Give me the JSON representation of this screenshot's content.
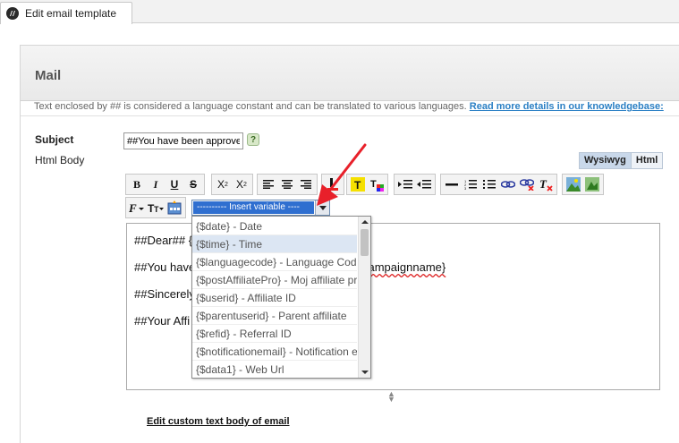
{
  "tab": {
    "label": "Edit email template",
    "icon": "app-logo-icon"
  },
  "panel": {
    "title": "Mail",
    "note": "Text enclosed by ## is considered a language constant and can be translated to various languages.",
    "note_link": "Read more details in our knowledgebase:"
  },
  "form": {
    "subject_label": "Subject",
    "subject_value": "##You have been approved##",
    "help": "?",
    "body_label": "Html Body"
  },
  "editor_modes": {
    "wysiwyg": "Wysiwyg",
    "html": "Html",
    "active": "Wysiwyg"
  },
  "toolbar": {
    "bold": "B",
    "italic": "I",
    "underline": "U",
    "strike": "S",
    "subscript": "X",
    "superscript": "X",
    "insert_variable": "---------- Insert variable ----"
  },
  "editor_content": {
    "line1": "##Dear## {",
    "line2_start": "##You have",
    "line2_end": "campaignname}",
    "line3": "##Sincerely",
    "line4": "##Your Affi"
  },
  "variable_dropdown": [
    "{$date} - Date",
    "{$time} - Time",
    "{$languagecode} - Language Cod",
    "{$postAffiliatePro} - Moj affiliate pr",
    "{$userid} - Affiliate ID",
    "{$parentuserid} - Parent affiliate",
    "{$refid} - Referral ID",
    "{$notificationemail} - Notification e",
    "{$data1} - Web Url"
  ],
  "highlighted_index": 1,
  "edit_custom_link": "Edit custom text body of email",
  "colors": {
    "accent": "#2f6fd0",
    "annotation_arrow": "#e8202a",
    "link": "#2a7fc4"
  }
}
